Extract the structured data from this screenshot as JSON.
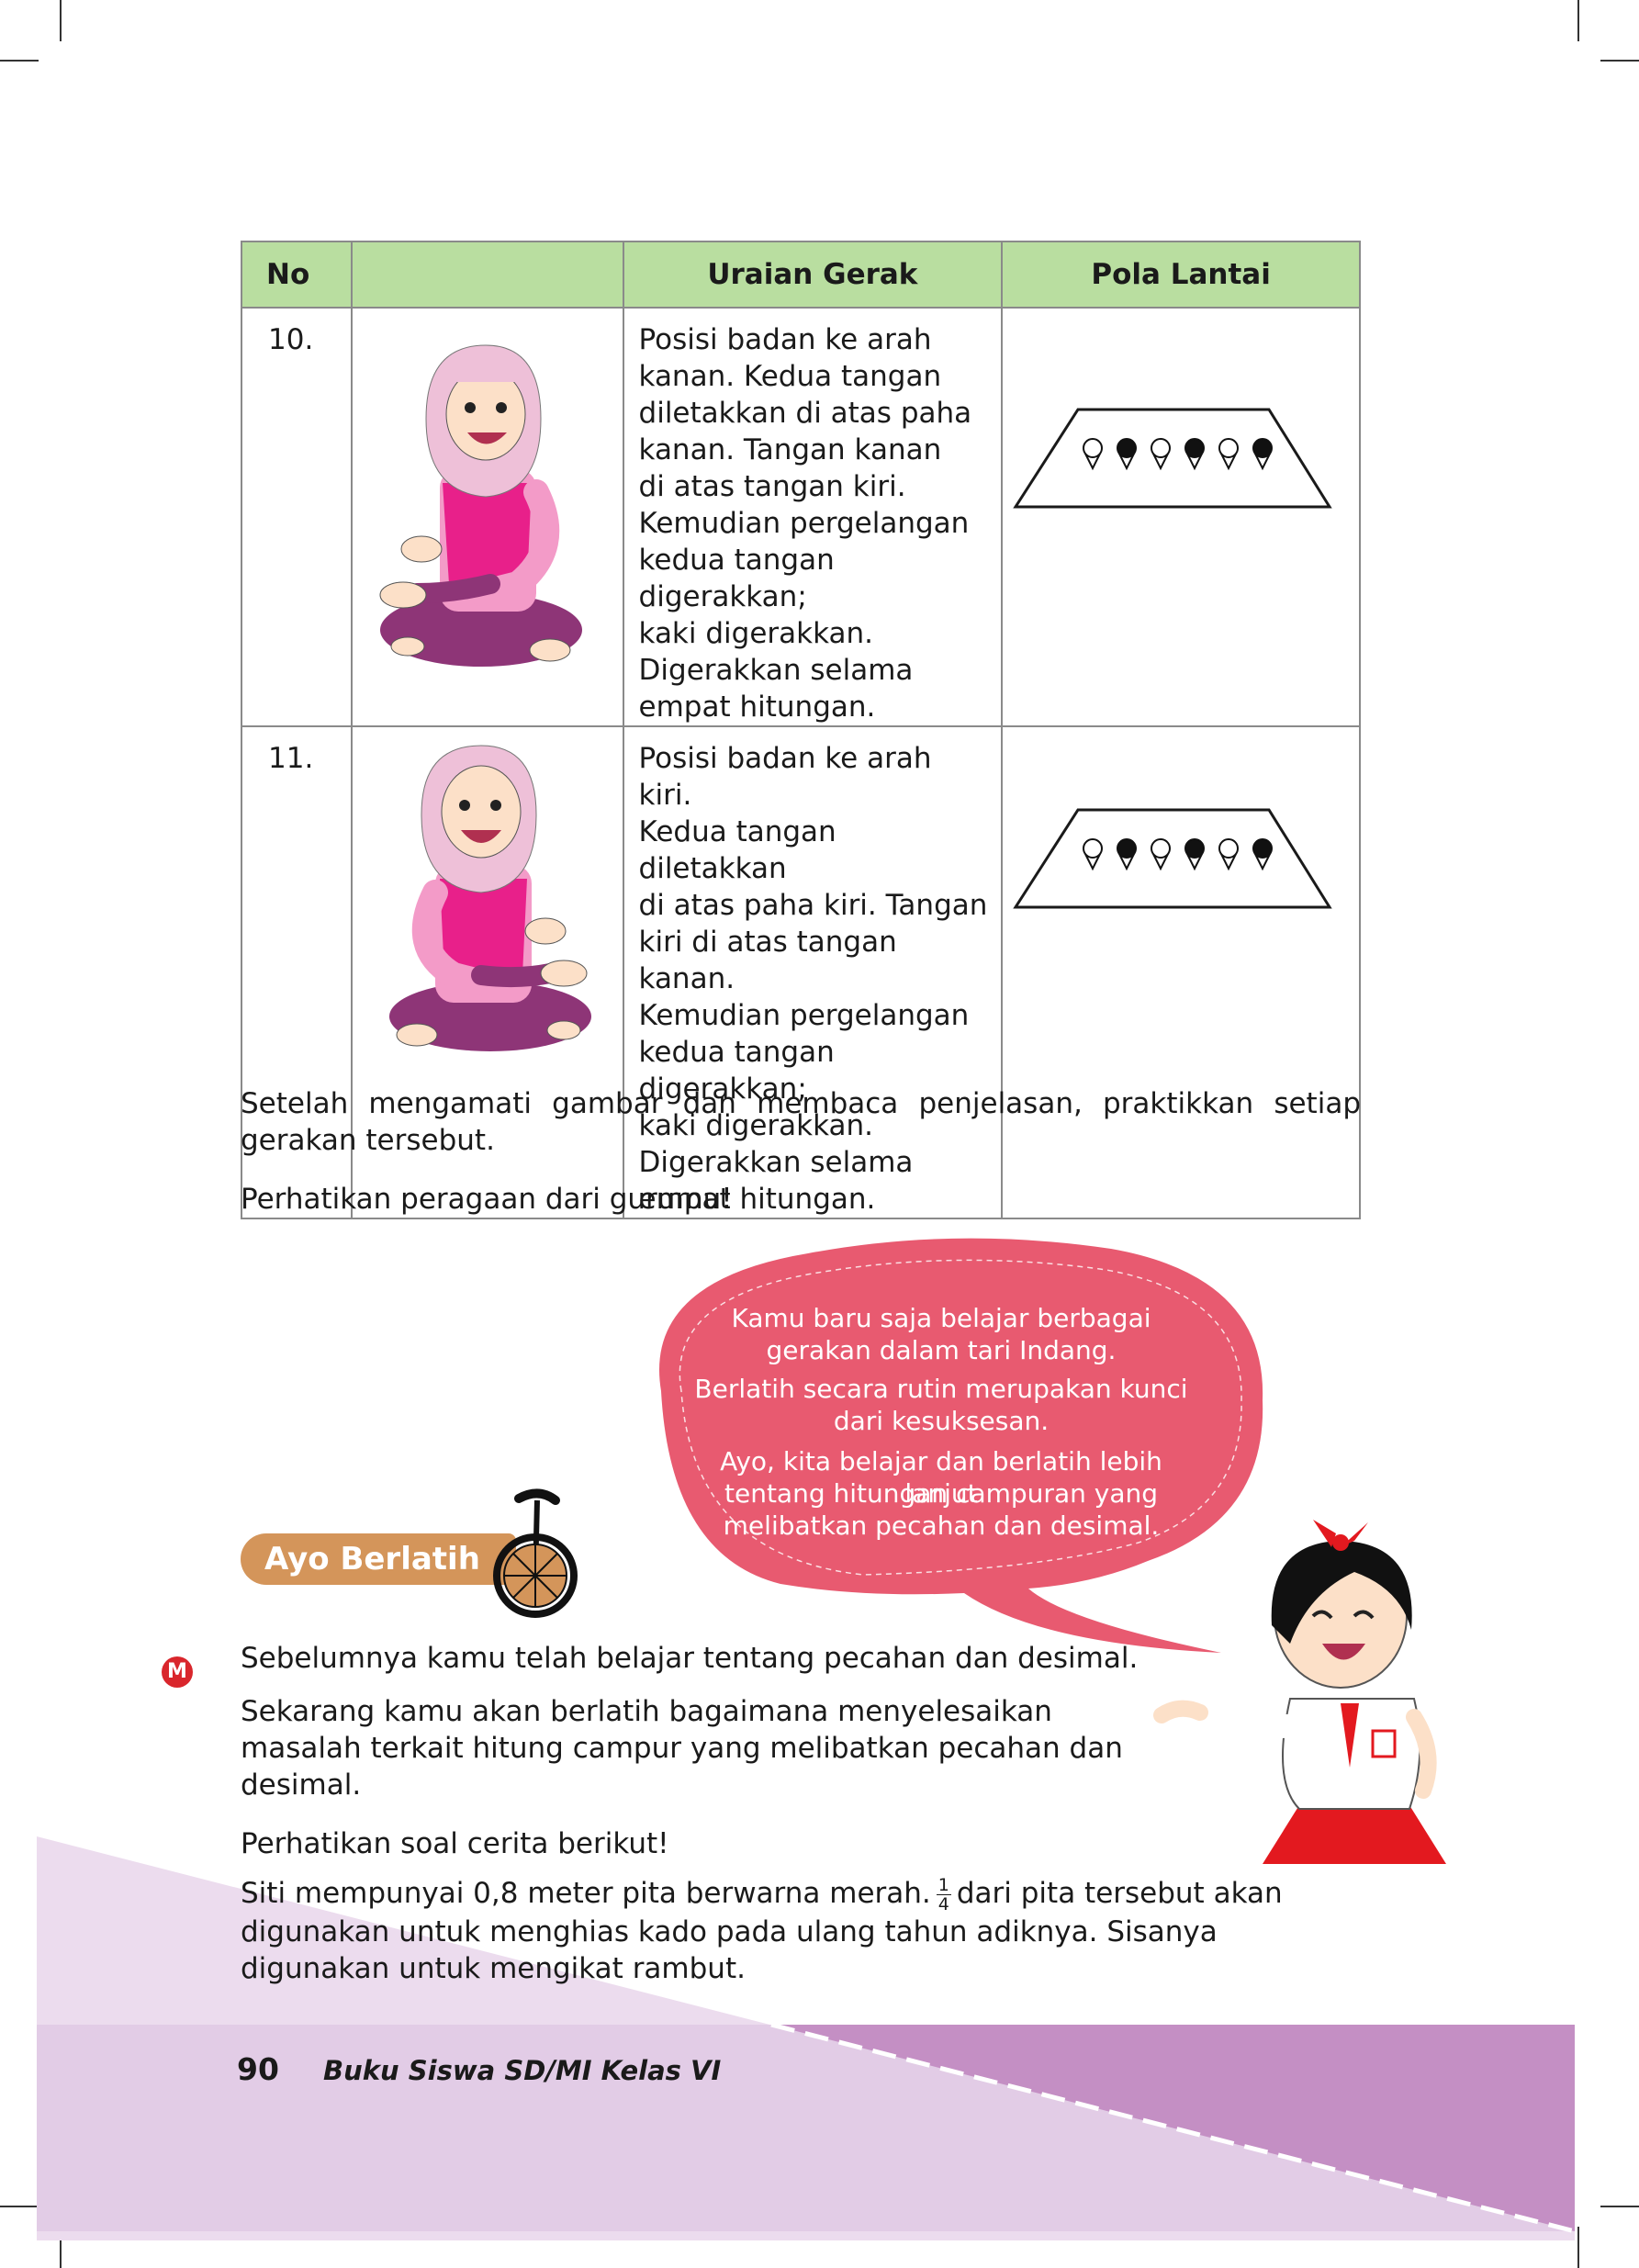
{
  "table": {
    "headers": {
      "no": "No",
      "image": "",
      "uraian": "Uraian Gerak",
      "pola": "Pola Lantai"
    },
    "rows": [
      {
        "no": "10.",
        "uraian": "Posisi badan ke arah\nkanan. Kedua tangan\ndiletakkan di atas paha\nkanan. Tangan kanan\ndi atas tangan kiri.\nKemudian pergelangan\nkedua tangan digerakkan;\nkaki digerakkan.\nDigerakkan selama\nempat hitungan.",
        "dancers": [
          "open",
          "filled",
          "open",
          "filled",
          "open",
          "filled"
        ]
      },
      {
        "no": "11.",
        "uraian": "Posisi badan ke arah kiri.\nKedua tangan diletakkan\ndi atas paha kiri. Tangan\nkiri di atas tangan kanan.\nKemudian pergelangan\nkedua tangan digerakkan;\nkaki digerakkan.\nDigerakkan selama\nempat hitungan.",
        "dancers": [
          "open",
          "filled",
          "open",
          "filled",
          "open",
          "filled"
        ]
      }
    ]
  },
  "after_table": {
    "p1": "Setelah mengamati gambar dan membaca penjelasan, praktikkan setiap gerakan tersebut.",
    "p2": "Perhatikan peragaan dari gurumu!"
  },
  "speech_bubble": {
    "line1": "Kamu baru saja belajar berbagai",
    "line2": "gerakan dalam tari Indang.",
    "line3": "Berlatih secara rutin merupakan kunci",
    "line4": "dari kesuksesan.",
    "line5": "Ayo, kita belajar dan berlatih lebih lanjut",
    "line6": "tentang hitungan campuran yang",
    "line7": "melibatkan pecahan dan desimal.",
    "color": "#e85a70"
  },
  "section": {
    "label": "Ayo Berlatih",
    "badge": "M"
  },
  "body": {
    "p1": "Sebelumnya kamu telah belajar tentang pecahan dan desimal.",
    "p2": "Sekarang kamu akan berlatih bagaimana menyelesaikan\nmasalah terkait hitung campur yang melibatkan pecahan dan\ndesimal.",
    "p3": "Perhatikan soal cerita berikut!",
    "p4_before": "Siti mempunyai 0,8 meter pita berwarna merah.",
    "frac_num": "1",
    "frac_den": "4",
    "p4_after": "dari pita tersebut akan",
    "p4_line2": "digunakan untuk menghias kado pada ulang tahun adiknya. Sisanya",
    "p4_line3": "digunakan untuk mengikat rambut."
  },
  "footer": {
    "page": "90",
    "book": "Buku Siswa SD/MI Kelas VI"
  },
  "colors": {
    "header_green": "#b9dea0",
    "footer_light": "#e2cce6",
    "footer_dark": "#c48fc4",
    "hijab_pink": "#eec0d8",
    "vest": "#e8208a",
    "pants": "#8e3577"
  }
}
